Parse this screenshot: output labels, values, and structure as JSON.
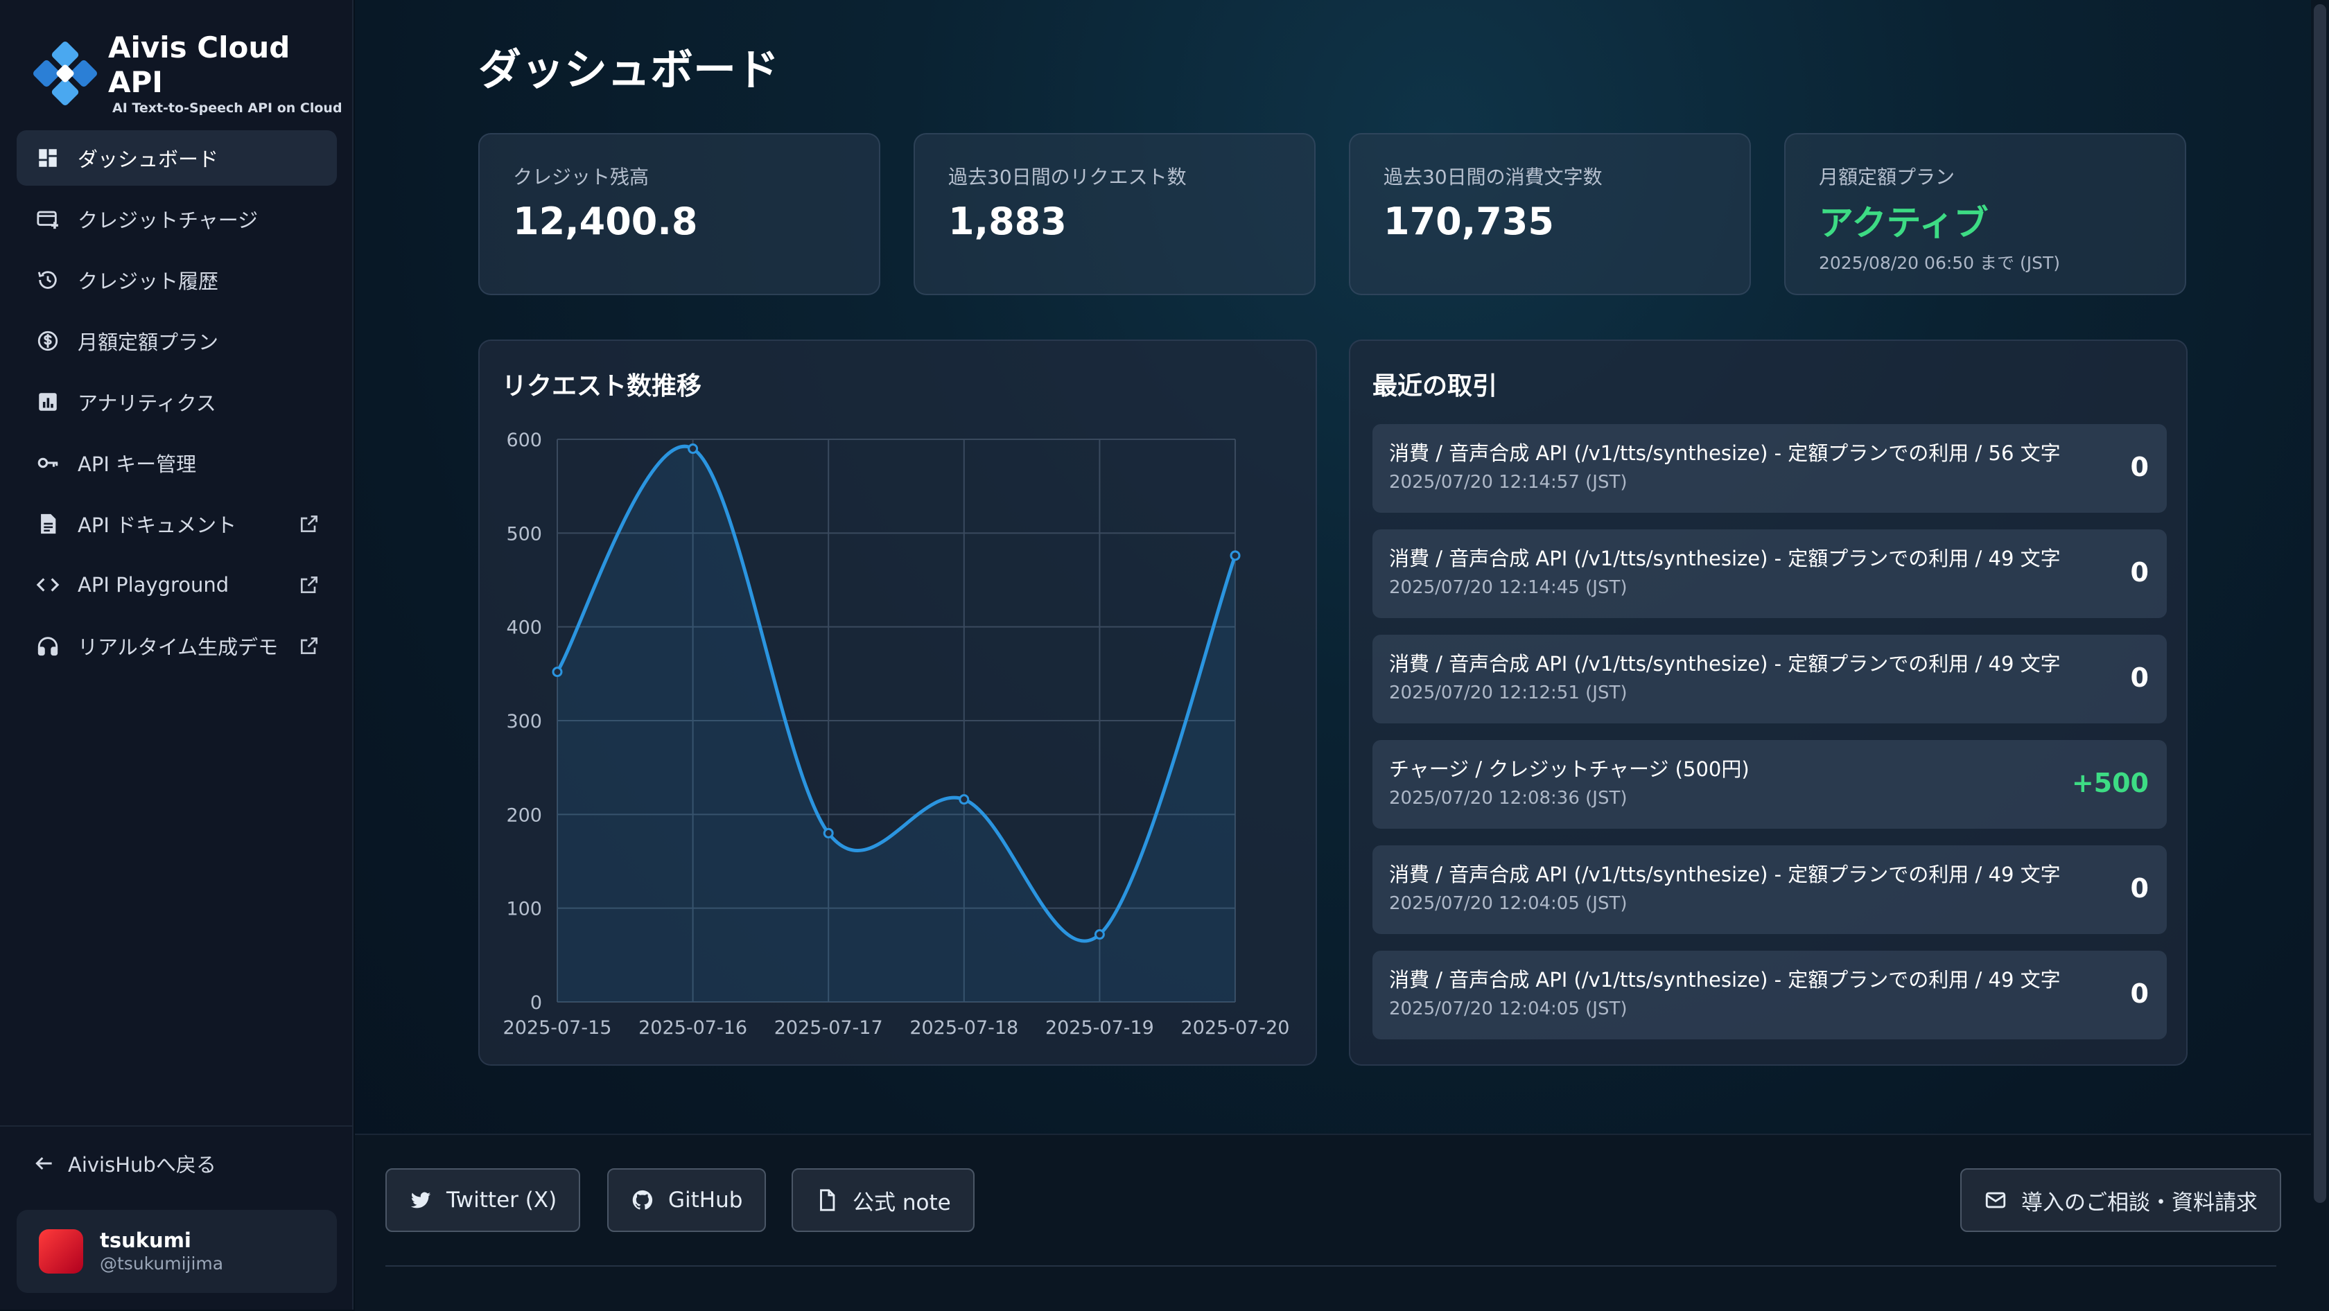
{
  "brand": {
    "title": "Aivis Cloud API",
    "subtitle": "AI Text-to-Speech API on Cloud"
  },
  "sidebar": {
    "items": [
      {
        "label": "ダッシュボード",
        "icon": "dashboard-icon",
        "active": true
      },
      {
        "label": "クレジットチャージ",
        "icon": "credit-card-plus-icon"
      },
      {
        "label": "クレジット履歴",
        "icon": "history-icon"
      },
      {
        "label": "月額定額プラン",
        "icon": "dollar-cycle-icon"
      },
      {
        "label": "アナリティクス",
        "icon": "analytics-icon"
      },
      {
        "label": "API キー管理",
        "icon": "key-icon"
      },
      {
        "label": "API ドキュメント",
        "icon": "document-icon",
        "external": true
      },
      {
        "label": "API Playground",
        "icon": "code-icon",
        "external": true
      },
      {
        "label": "リアルタイム生成デモ",
        "icon": "headphones-icon",
        "external": true
      }
    ],
    "back_label": "AivisHubへ戻る",
    "user": {
      "name": "tsukumi",
      "handle": "@tsukumijima"
    }
  },
  "page": {
    "title": "ダッシュボード"
  },
  "stats": {
    "credit_label": "クレジット残高",
    "credit_value": "12,400.8",
    "requests_label": "過去30日間のリクエスト数",
    "requests_value": "1,883",
    "chars_label": "過去30日間の消費文字数",
    "chars_value": "170,735",
    "plan_label": "月額定額プラン",
    "plan_status": "アクティブ",
    "plan_until": "2025/08/20 06:50 まで (JST)"
  },
  "chart_panel": {
    "title": "リクエスト数推移"
  },
  "chart_data": {
    "type": "line",
    "title": "リクエスト数推移",
    "x": [
      "2025-07-15",
      "2025-07-16",
      "2025-07-17",
      "2025-07-18",
      "2025-07-19",
      "2025-07-20"
    ],
    "series": [
      {
        "values": [
          352,
          590,
          180,
          216,
          72,
          476
        ]
      }
    ],
    "ylim": [
      0,
      600
    ],
    "yticks": [
      0,
      100,
      200,
      300,
      400,
      500,
      600
    ],
    "grid": true,
    "color": "#2b95e0"
  },
  "transactions": {
    "title": "最近の取引",
    "items": [
      {
        "title": "消費 / 音声合成 API (/v1/tts/synthesize) - 定額プランでの利用 / 56 文字",
        "time": "2025/07/20 12:14:57 (JST)",
        "amount": "0"
      },
      {
        "title": "消費 / 音声合成 API (/v1/tts/synthesize) - 定額プランでの利用 / 49 文字",
        "time": "2025/07/20 12:14:45 (JST)",
        "amount": "0"
      },
      {
        "title": "消費 / 音声合成 API (/v1/tts/synthesize) - 定額プランでの利用 / 49 文字",
        "time": "2025/07/20 12:12:51 (JST)",
        "amount": "0"
      },
      {
        "title": "チャージ / クレジットチャージ (500円)",
        "time": "2025/07/20 12:08:36 (JST)",
        "amount": "+500",
        "positive": true
      },
      {
        "title": "消費 / 音声合成 API (/v1/tts/synthesize) - 定額プランでの利用 / 49 文字",
        "time": "2025/07/20 12:04:05 (JST)",
        "amount": "0"
      },
      {
        "title": "消費 / 音声合成 API (/v1/tts/synthesize) - 定額プランでの利用 / 49 文字",
        "time": "2025/07/20 12:04:05 (JST)",
        "amount": "0"
      }
    ]
  },
  "footer": {
    "twitter": "Twitter (X)",
    "github": "GitHub",
    "note": "公式 note",
    "contact": "導入のご相談・資料請求"
  },
  "colors": {
    "accent": "#2b95e0",
    "positive": "#3ddc84"
  }
}
